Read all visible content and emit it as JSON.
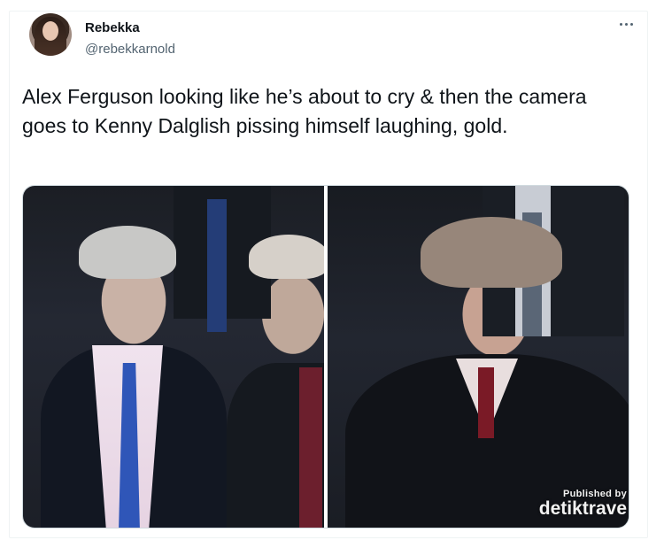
{
  "user": {
    "display_name": "Rebekka",
    "handle": "@rebekkarnold",
    "avatar_icon": "profile-photo"
  },
  "actions": {
    "more_icon": "more-horizontal-icon"
  },
  "tweet": {
    "text": "Alex Ferguson looking like he’s about to cry & then the camera goes to Kenny Dalglish pissing himself laughing, gold."
  },
  "media": {
    "photo_count": 2,
    "watermark_line1": "Published by",
    "watermark_line2": "detiktrave"
  },
  "colors": {
    "text_primary": "#0f1419",
    "text_secondary": "#536471",
    "border": "#cfd9de"
  }
}
